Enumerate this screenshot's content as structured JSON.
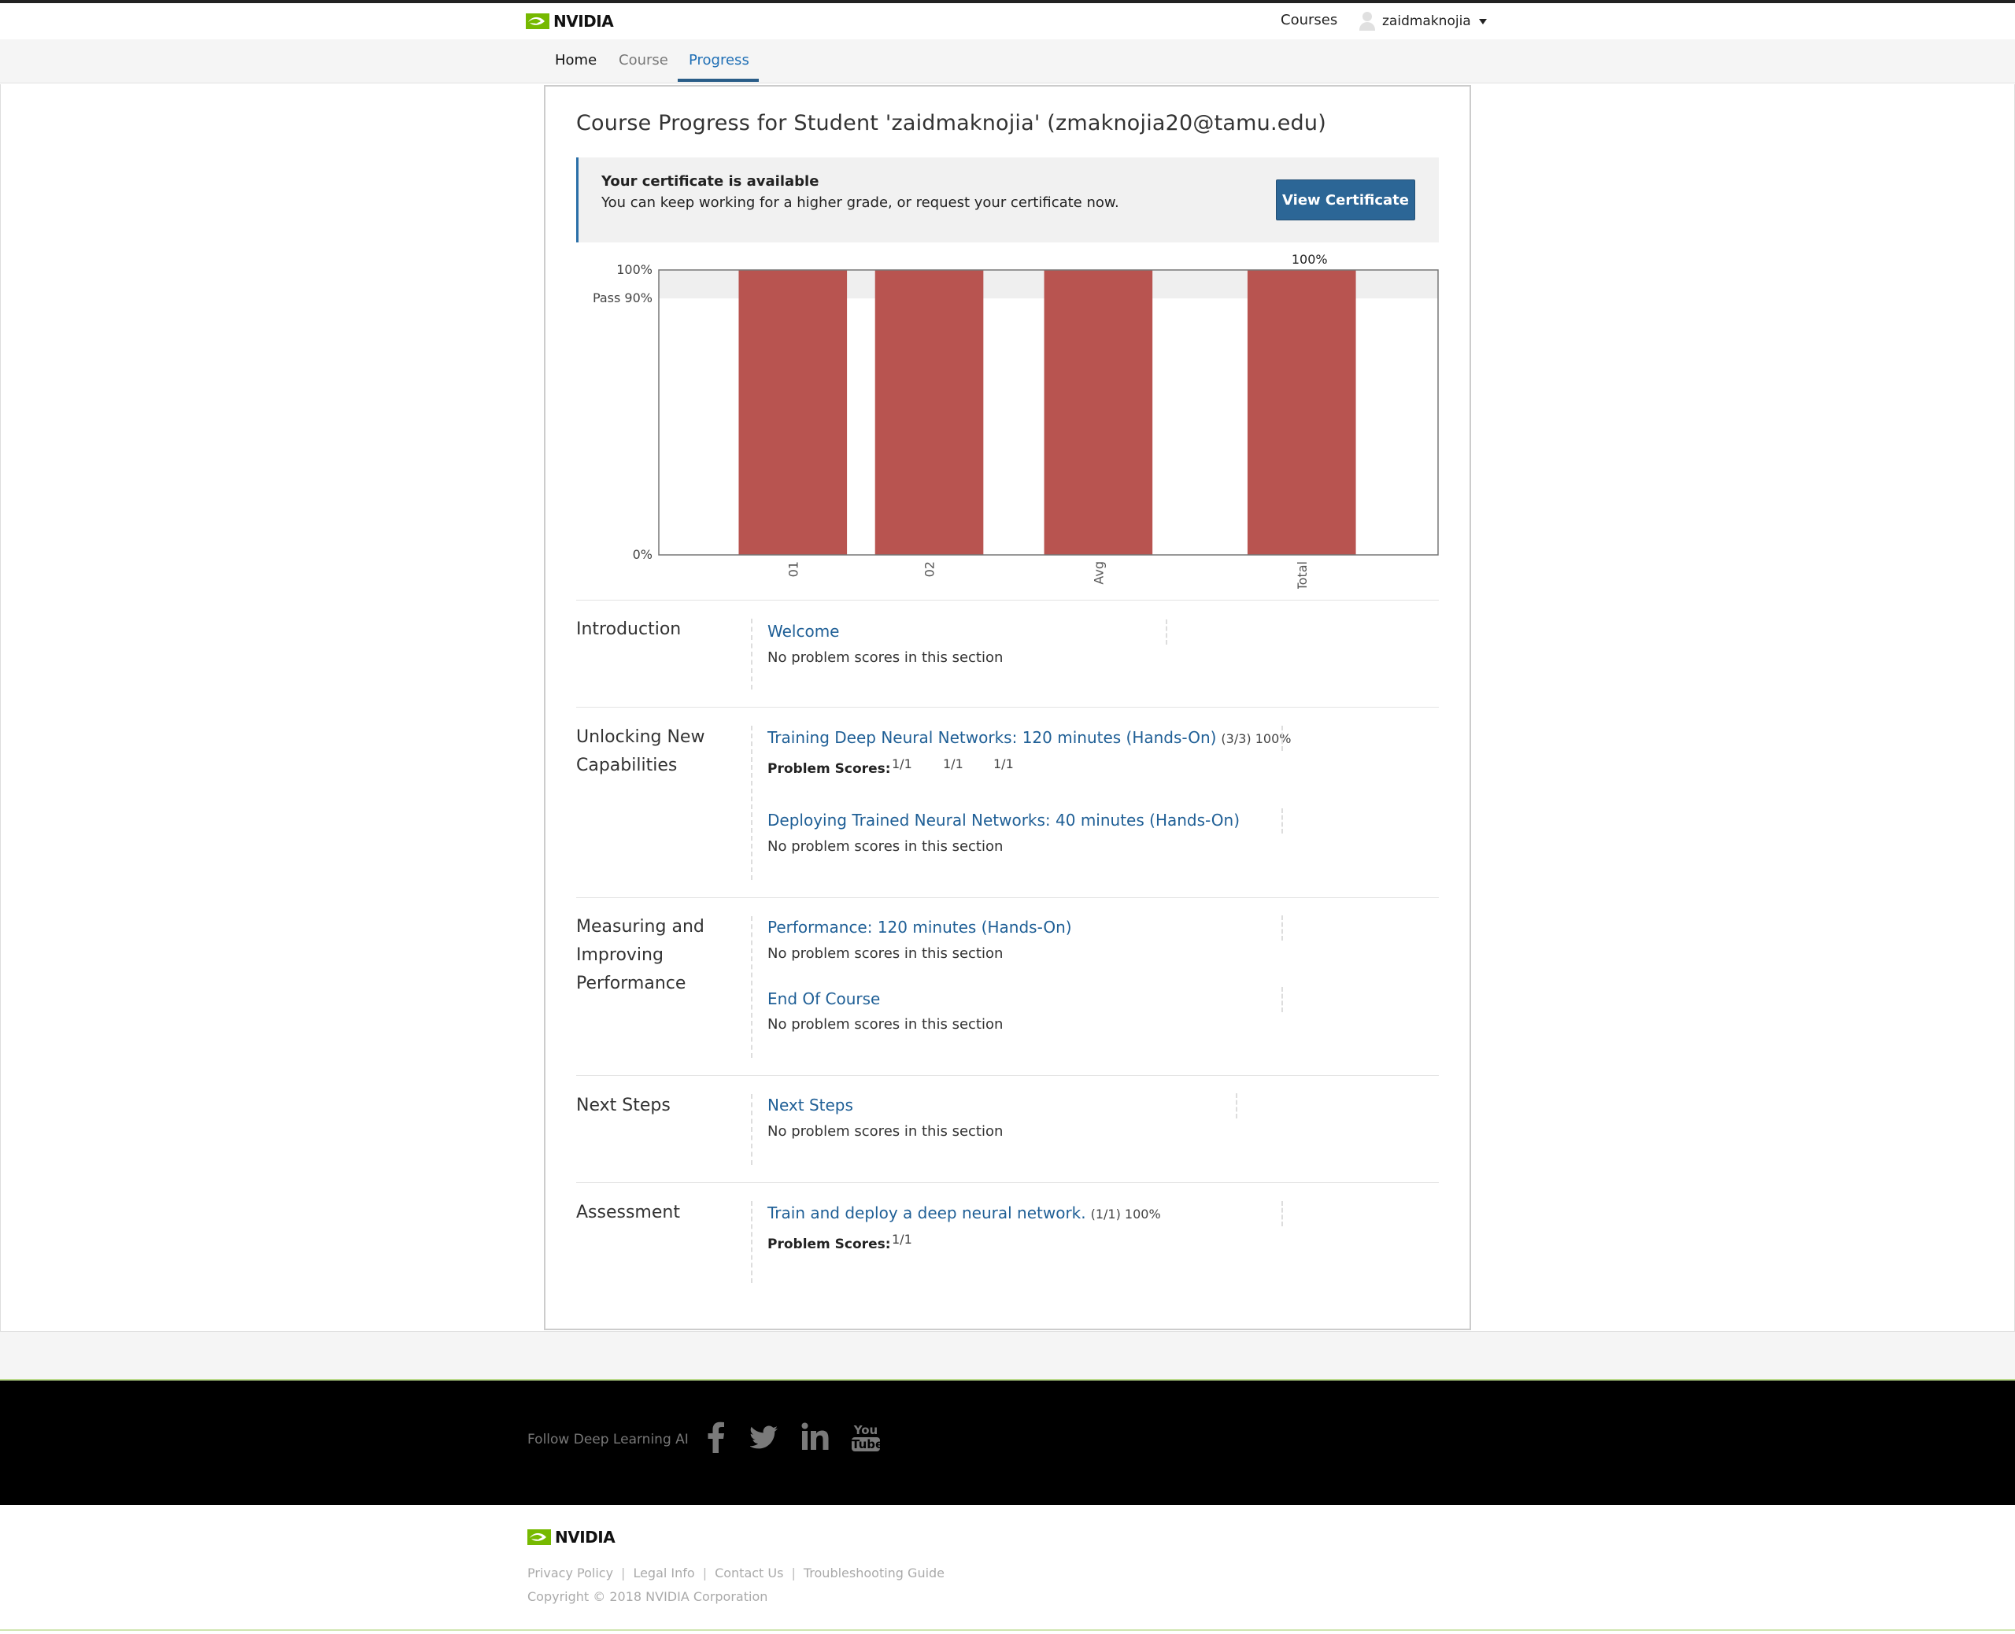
{
  "header": {
    "brand": "NVIDIA",
    "courses_link": "Courses",
    "username": "zaidmaknojia"
  },
  "nav": {
    "tabs": [
      {
        "label": "Home"
      },
      {
        "label": "Course"
      },
      {
        "label": "Progress"
      }
    ],
    "active": "Progress"
  },
  "page": {
    "title": "Course Progress for Student 'zaidmaknojia' (zmaknojia20@tamu.edu)"
  },
  "certificate": {
    "title": "Your certificate is available",
    "message": "You can keep working for a higher grade, or request your certificate now.",
    "button": "View Certificate"
  },
  "chart_data": {
    "type": "bar",
    "categories": [
      "01",
      "02",
      "Avg",
      "Total"
    ],
    "values": [
      100,
      100,
      100,
      100
    ],
    "ylim": [
      0,
      100
    ],
    "pass_line": 90,
    "y_tick_labels": [
      "100%",
      "Pass 90%",
      "0%"
    ],
    "total_label": "100%",
    "bar_color": "#b85450",
    "pass_band_color": "#efefef"
  },
  "chapters": [
    {
      "name": "Introduction",
      "sections": [
        {
          "title": "Welcome",
          "meta": "",
          "note": "No problem scores in this section",
          "scores": []
        }
      ]
    },
    {
      "name": "Unlocking New Capabilities",
      "sections": [
        {
          "title": "Training Deep Neural Networks: 120 minutes (Hands-On)",
          "meta": "(3/3) 100%",
          "note": "",
          "scores_label": "Problem Scores:",
          "scores": [
            "1/1",
            "1/1",
            "1/1"
          ]
        },
        {
          "title": "Deploying Trained Neural Networks: 40 minutes (Hands-On)",
          "meta": "",
          "note": "No problem scores in this section",
          "scores": []
        }
      ]
    },
    {
      "name": "Measuring and Improving Performance",
      "sections": [
        {
          "title": "Performance: 120 minutes (Hands-On)",
          "meta": "",
          "note": "No problem scores in this section",
          "scores": []
        },
        {
          "title": "End Of Course",
          "meta": "",
          "note": "No problem scores in this section",
          "scores": []
        }
      ]
    },
    {
      "name": "Next Steps",
      "sections": [
        {
          "title": "Next Steps",
          "meta": "",
          "note": "No problem scores in this section",
          "scores": []
        }
      ]
    },
    {
      "name": "Assessment",
      "sections": [
        {
          "title": "Train and deploy a deep neural network.",
          "meta": "(1/1) 100%",
          "note": "",
          "scores_label": "Problem Scores:",
          "scores": [
            "1/1"
          ]
        }
      ]
    }
  ],
  "footer": {
    "follow_text": "Follow Deep Learning AI",
    "social_icons": [
      "facebook-icon",
      "twitter-icon",
      "linkedin-icon",
      "youtube-icon"
    ],
    "youtube_you": "You",
    "youtube_tube": "Tube",
    "brand": "NVIDIA",
    "links": [
      "Privacy Policy",
      "Legal Info",
      "Contact Us",
      "Troubleshooting Guide"
    ],
    "link_separator": "|",
    "copyright": "Copyright © 2018 NVIDIA Corporation"
  },
  "colors": {
    "accent": "#2c6696",
    "link": "#1f5f96",
    "nvidia_green": "#76b900"
  }
}
